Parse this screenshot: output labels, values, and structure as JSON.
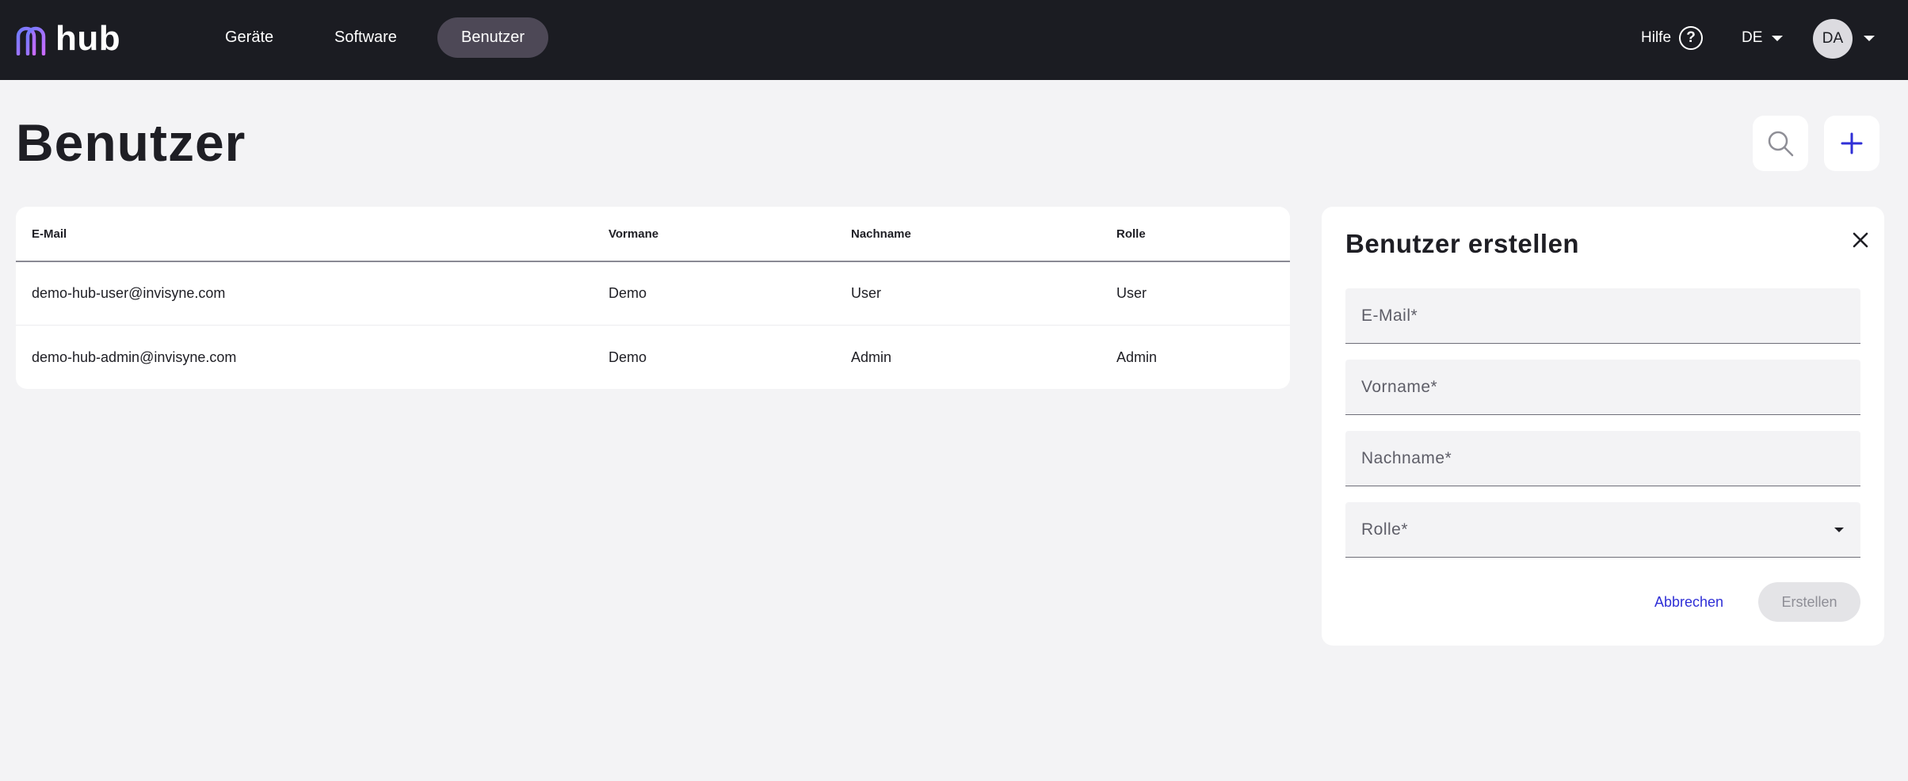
{
  "header": {
    "brand": "hub",
    "nav": [
      {
        "label": "Geräte",
        "active": false
      },
      {
        "label": "Software",
        "active": false
      },
      {
        "label": "Benutzer",
        "active": true
      }
    ],
    "help_label": "Hilfe",
    "help_icon": "help-circle-icon",
    "language": "DE",
    "avatar_initials": "DA",
    "colors": {
      "bar_background": "#1b1c22",
      "active_nav_background": "#4d4856",
      "logo_gradient": [
        "#6d7cff",
        "#c86bff"
      ]
    }
  },
  "page": {
    "title": "Benutzer",
    "search_icon": "search-icon",
    "add_icon": "plus-icon",
    "accent_color": "#2f2fd6"
  },
  "table": {
    "columns": [
      "E-Mail",
      "Vormane",
      "Nachname",
      "Rolle"
    ],
    "rows": [
      [
        "demo-hub-user@invisyne.com",
        "Demo",
        "User",
        "User"
      ],
      [
        "demo-hub-admin@invisyne.com",
        "Demo",
        "Admin",
        "Admin"
      ]
    ]
  },
  "create_panel": {
    "title": "Benutzer erstellen",
    "close_icon": "close-icon",
    "fields": {
      "email": {
        "placeholder": "E-Mail*",
        "value": ""
      },
      "vorname": {
        "placeholder": "Vorname*",
        "value": ""
      },
      "nachname": {
        "placeholder": "Nachname*",
        "value": ""
      },
      "rolle": {
        "label": "Rolle*",
        "selected": ""
      }
    },
    "cancel_label": "Abbrechen",
    "create_label": "Erstellen"
  }
}
